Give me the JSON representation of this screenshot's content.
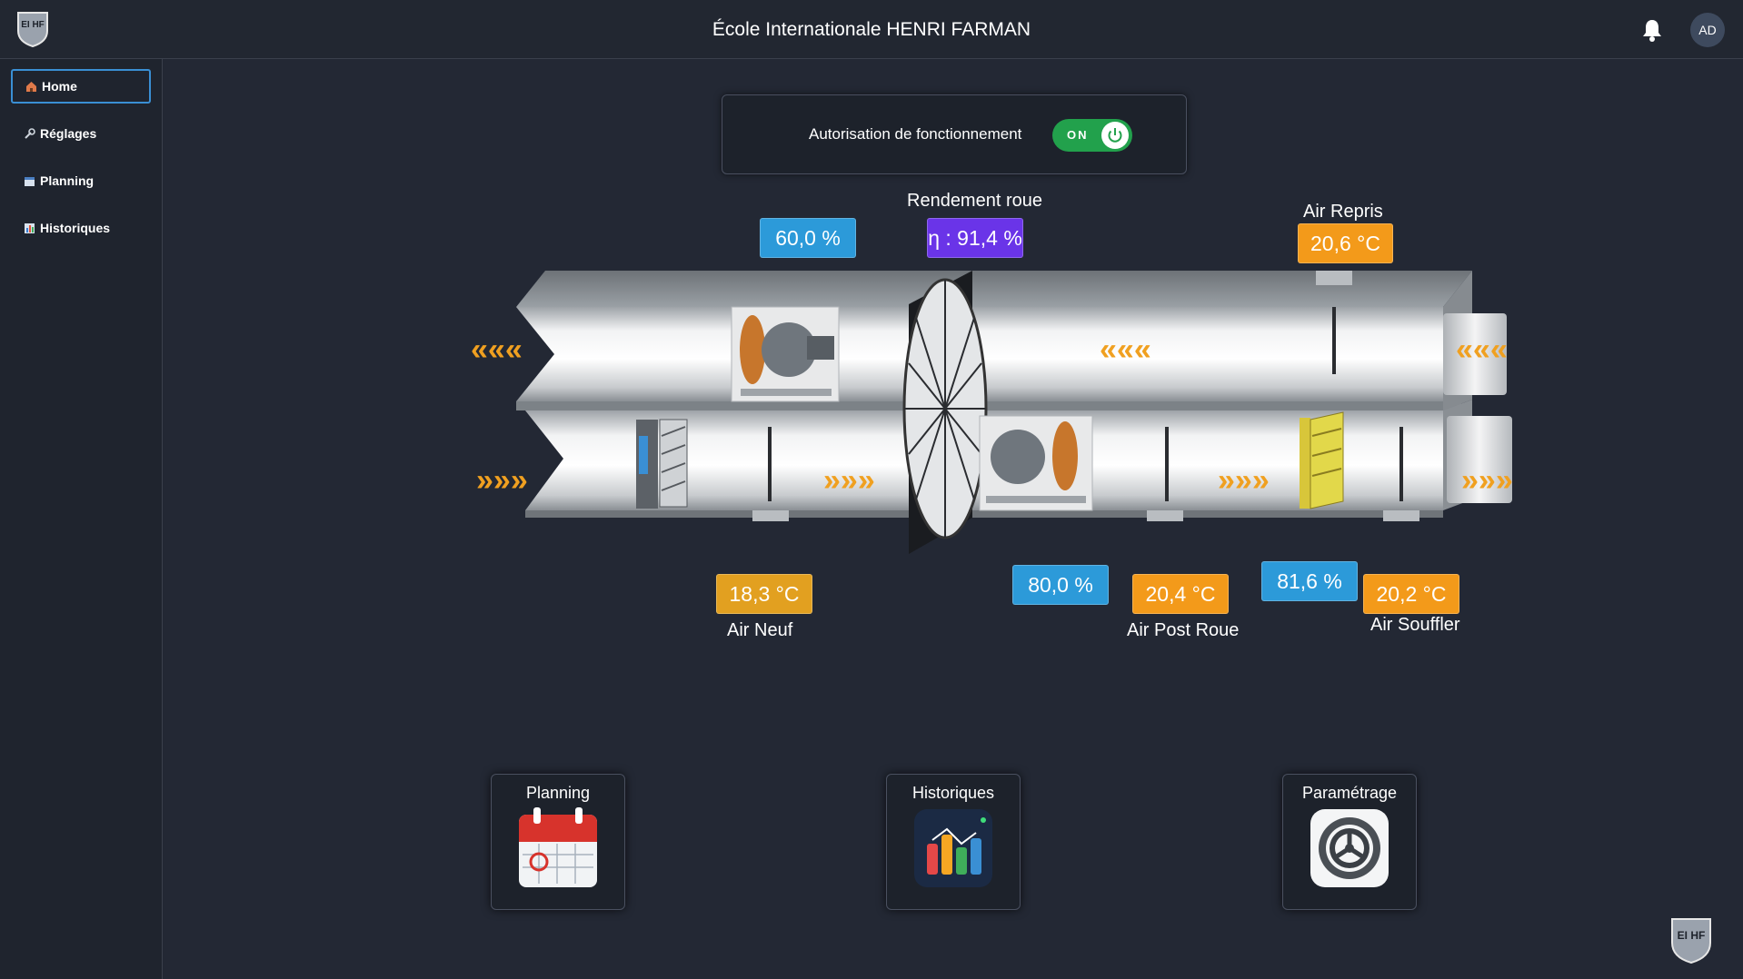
{
  "header": {
    "title": "École Internationale HENRI FARMAN",
    "user_initials": "AD",
    "logo_text": "EI HF"
  },
  "sidebar": {
    "items": [
      {
        "label": "Home",
        "icon": "house-icon",
        "active": true
      },
      {
        "label": "Réglages",
        "icon": "wrench-icon",
        "active": false
      },
      {
        "label": "Planning",
        "icon": "calendar-icon",
        "active": false
      },
      {
        "label": "Historiques",
        "icon": "chart-icon",
        "active": false
      }
    ]
  },
  "authorization": {
    "label": "Autorisation de fonctionnement",
    "state": "ON"
  },
  "readings": {
    "extract_fan_speed": "60,0 %",
    "wheel_efficiency_title": "Rendement roue",
    "wheel_efficiency": "η : 91,4 %",
    "air_repris_title": "Air Repris",
    "air_repris_temp": "20,6 °C",
    "air_neuf_temp": "18,3 °C",
    "air_neuf_title": "Air Neuf",
    "supply_fan_speed": "80,0 %",
    "air_post_roue_temp": "20,4 °C",
    "air_post_roue_title": "Air Post Roue",
    "valve_position": "81,6 %",
    "air_souffler_temp": "20,2 °C",
    "air_souffler_title": "Air Souffler"
  },
  "shortcuts": [
    {
      "label": "Planning",
      "icon": "calendar-icon"
    },
    {
      "label": "Historiques",
      "icon": "chart-icon"
    },
    {
      "label": "Paramétrage",
      "icon": "gear-icon"
    }
  ],
  "colors": {
    "background": "#232834",
    "blue_badge": "#2c9ad9",
    "orange_badge": "#f39a1a",
    "purple_badge": "#6a34e8",
    "toggle_on": "#22a14c",
    "arrow": "#f0a020"
  }
}
